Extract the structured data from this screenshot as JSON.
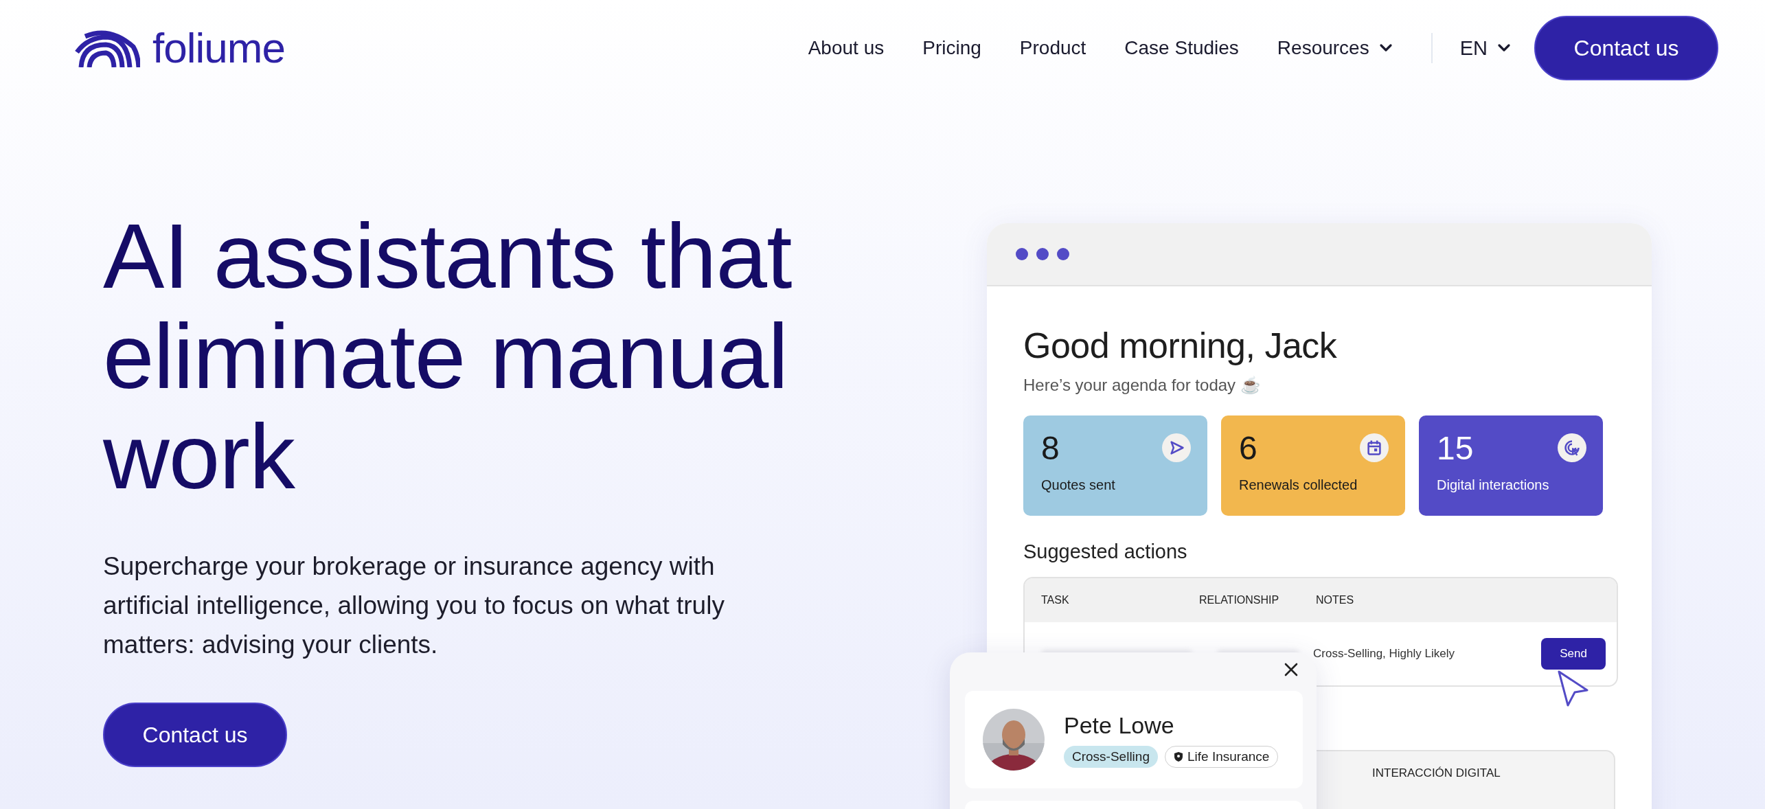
{
  "logo": {
    "text": "foliume"
  },
  "nav": {
    "links": [
      {
        "label": "About us",
        "dropdown": false
      },
      {
        "label": "Pricing",
        "dropdown": false
      },
      {
        "label": "Product",
        "dropdown": false
      },
      {
        "label": "Case Studies",
        "dropdown": false
      },
      {
        "label": "Resources",
        "dropdown": true
      }
    ],
    "language": "EN",
    "cta": "Contact us"
  },
  "hero": {
    "headline_lines": [
      "AI assistants that",
      "eliminate manual",
      "work"
    ],
    "subtitle": "Supercharge your brokerage or insurance agency with artificial intelligence, allowing you to focus on what truly matters: advising your clients.",
    "cta": "Contact us"
  },
  "dashboard": {
    "greeting": "Good morning, Jack",
    "agenda": "Here’s your agenda for today ☕",
    "stats": [
      {
        "value": "8",
        "label": "Quotes sent",
        "color": "#9ecae1"
      },
      {
        "value": "6",
        "label": "Renewals collected",
        "color": "#f2b74e"
      },
      {
        "value": "15",
        "label": "Digital interactions",
        "color": "#534bc6"
      }
    ],
    "suggested_title": "Suggested actions",
    "table": {
      "columns": [
        "TASK",
        "RELATIONSHIP",
        "NOTES"
      ],
      "rows": [
        {
          "notes": "Cross-Selling, Highly Likely",
          "action": "Send"
        }
      ]
    },
    "second_table": {
      "columns": [
        "INTERACCIÓN DIGITAL"
      ]
    },
    "contact_popup": {
      "name": "Pete Lowe",
      "tags": [
        {
          "label": "Cross-Selling",
          "kind": "filled"
        },
        {
          "label": "Life Insurance",
          "kind": "outline"
        }
      ]
    }
  }
}
